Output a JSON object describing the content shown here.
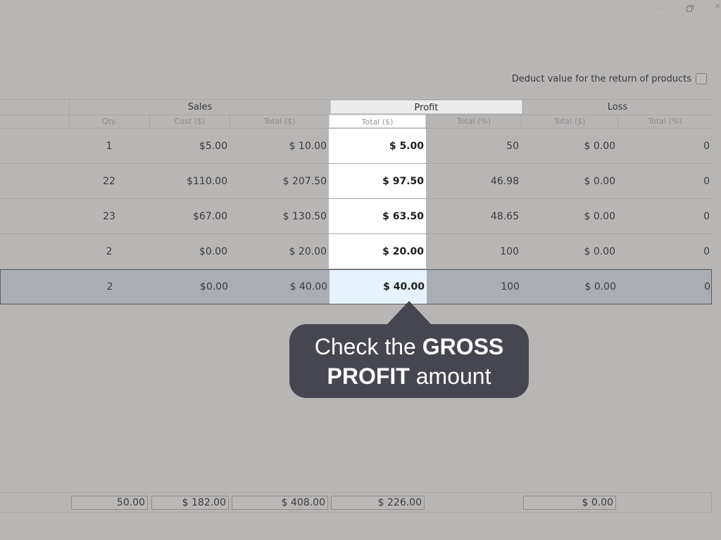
{
  "window": {
    "close_glyph": "×"
  },
  "options": {
    "deduct_label": "Deduct value for the return of products",
    "deduct_checked": false
  },
  "table": {
    "group_headers": {
      "sales": "Sales",
      "profit": "Profit",
      "loss": "Loss"
    },
    "sub_headers": {
      "qty": "Qty.",
      "cost": "Cost ($)",
      "sales_total": "Total ($)",
      "profit_total": "Total ($)",
      "profit_pct": "Total (%)",
      "loss_total": "Total ($)",
      "loss_pct": "Total (%)"
    },
    "rows": [
      {
        "qty": "1",
        "cost": "$5.00",
        "sales_total": "$ 10.00",
        "profit_total": "$ 5.00",
        "profit_pct": "50",
        "loss_total": "$ 0.00",
        "loss_pct": "0"
      },
      {
        "qty": "22",
        "cost": "$110.00",
        "sales_total": "$ 207.50",
        "profit_total": "$ 97.50",
        "profit_pct": "46.98",
        "loss_total": "$ 0.00",
        "loss_pct": "0"
      },
      {
        "qty": "23",
        "cost": "$67.00",
        "sales_total": "$ 130.50",
        "profit_total": "$ 63.50",
        "profit_pct": "48.65",
        "loss_total": "$ 0.00",
        "loss_pct": "0"
      },
      {
        "qty": "2",
        "cost": "$0.00",
        "sales_total": "$ 20.00",
        "profit_total": "$ 20.00",
        "profit_pct": "100",
        "loss_total": "$ 0.00",
        "loss_pct": "0"
      },
      {
        "qty": "2",
        "cost": "$0.00",
        "sales_total": "$ 40.00",
        "profit_total": "$ 40.00",
        "profit_pct": "100",
        "loss_total": "$ 0.00",
        "loss_pct": "0",
        "selected": true
      }
    ],
    "totals": {
      "qty": "50.00",
      "cost": "$ 182.00",
      "sales_total": "$ 408.00",
      "profit_total": "$ 226.00",
      "loss_total": "$ 0.00"
    }
  },
  "callout": {
    "prefix": "Check the",
    "bold1": "GROSS",
    "bold2": "PROFIT",
    "suffix": "amount"
  },
  "colors": {
    "overlay": "#b8b5b5",
    "callout_bg": "#464650",
    "highlight": "#ffffff",
    "selected_row": "#aaadb3"
  }
}
